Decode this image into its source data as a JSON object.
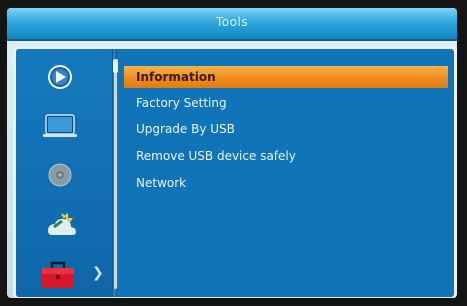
{
  "window": {
    "title": "Tools"
  },
  "sidebar": {
    "items": [
      {
        "icon": "play-icon"
      },
      {
        "icon": "monitor-icon"
      },
      {
        "icon": "disc-icon"
      },
      {
        "icon": "weather-icon"
      },
      {
        "icon": "toolbox-icon",
        "selected": true
      }
    ]
  },
  "menu": {
    "items": [
      {
        "label": "Information",
        "selected": true
      },
      {
        "label": "Factory Setting"
      },
      {
        "label": "Upgrade By USB"
      },
      {
        "label": "Remove USB device safely"
      },
      {
        "label": "Network"
      }
    ]
  },
  "colors": {
    "accent": "#ee8a1c",
    "panel": "#1274b8",
    "title_bar": "#2ea6dd"
  }
}
